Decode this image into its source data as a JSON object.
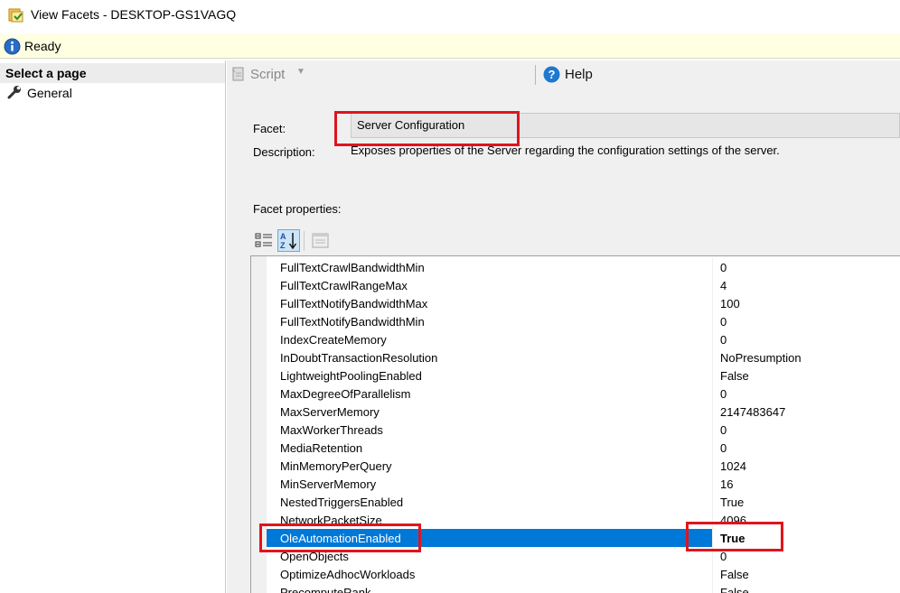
{
  "window": {
    "title": "View Facets - DESKTOP-GS1VAGQ"
  },
  "status": {
    "text": "Ready"
  },
  "left_pane": {
    "header": "Select a page",
    "pages": [
      {
        "label": "General"
      }
    ]
  },
  "toolbar": {
    "script_label": "Script",
    "help_label": "Help"
  },
  "form": {
    "facet_label": "Facet:",
    "facet_value": "Server Configuration",
    "description_label": "Description:",
    "description_value": "Exposes properties of the Server regarding the configuration settings of the server.",
    "properties_label": "Facet properties:"
  },
  "properties": [
    {
      "name": "FullTextCrawlBandwidthMin",
      "value": "0"
    },
    {
      "name": "FullTextCrawlRangeMax",
      "value": "4"
    },
    {
      "name": "FullTextNotifyBandwidthMax",
      "value": "100"
    },
    {
      "name": "FullTextNotifyBandwidthMin",
      "value": "0"
    },
    {
      "name": "IndexCreateMemory",
      "value": "0"
    },
    {
      "name": "InDoubtTransactionResolution",
      "value": "NoPresumption"
    },
    {
      "name": "LightweightPoolingEnabled",
      "value": "False"
    },
    {
      "name": "MaxDegreeOfParallelism",
      "value": "0"
    },
    {
      "name": "MaxServerMemory",
      "value": "2147483647"
    },
    {
      "name": "MaxWorkerThreads",
      "value": "0"
    },
    {
      "name": "MediaRetention",
      "value": "0"
    },
    {
      "name": "MinMemoryPerQuery",
      "value": "1024"
    },
    {
      "name": "MinServerMemory",
      "value": "16"
    },
    {
      "name": "NestedTriggersEnabled",
      "value": "True"
    },
    {
      "name": "NetworkPacketSize",
      "value": "4096"
    },
    {
      "name": "OleAutomationEnabled",
      "value": "True",
      "selected": true
    },
    {
      "name": "OpenObjects",
      "value": "0"
    },
    {
      "name": "OptimizeAdhocWorkloads",
      "value": "False"
    },
    {
      "name": "PrecomputeRank",
      "value": "False"
    }
  ],
  "colors": {
    "selection": "#0078d7",
    "highlight_box": "#e0141e",
    "status_bg": "#ffffe1"
  }
}
